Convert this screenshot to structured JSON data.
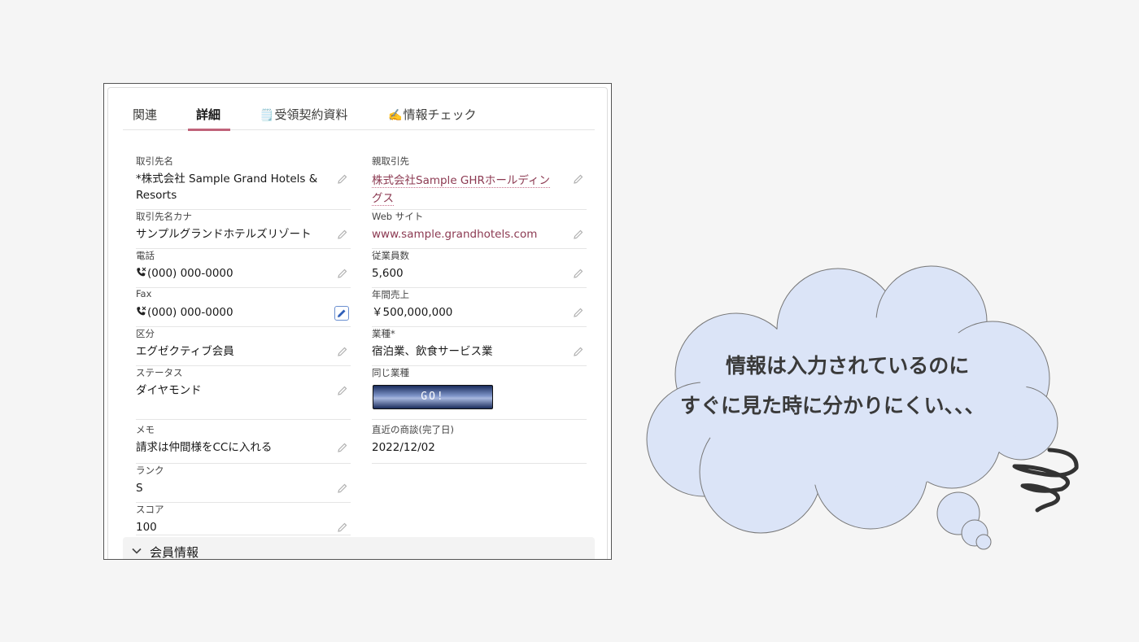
{
  "tabs": [
    {
      "label": "関連",
      "emoji": ""
    },
    {
      "label": "詳細",
      "emoji": ""
    },
    {
      "label": "受領契約資料",
      "emoji": "🗒️"
    },
    {
      "label": "情報チェック",
      "emoji": "✍️"
    }
  ],
  "left_fields": [
    {
      "label": "取引先名",
      "value": "*株式会社 Sample Grand Hotels & Resorts"
    },
    {
      "label": "取引先名カナ",
      "value": "サンプルグランドホテルズリゾート"
    },
    {
      "label": "電話",
      "value": "(000) 000-0000"
    },
    {
      "label": "Fax",
      "value": "(000) 000-0000"
    },
    {
      "label": "区分",
      "value": "エグゼクティブ会員"
    },
    {
      "label": "ステータス",
      "value": "ダイヤモンド"
    },
    {
      "label": "メモ",
      "value": "請求は仲間様をCCに入れる"
    },
    {
      "label": "ランク",
      "value": "S"
    },
    {
      "label": "スコア",
      "value": "100"
    }
  ],
  "right_fields": [
    {
      "label": "親取引先",
      "value": "株式会社Sample GHRホールディングス"
    },
    {
      "label": "Web サイト",
      "value": "www.sample.grandhotels.com"
    },
    {
      "label": "従業員数",
      "value": "5,600"
    },
    {
      "label": "年間売上",
      "value": "￥500,000,000"
    },
    {
      "label": "業種*",
      "value": "宿泊業、飲食サービス業"
    },
    {
      "label": "同じ業種",
      "value": ""
    },
    {
      "label": "直近の商談(完了日)",
      "value": "2022/12/02"
    }
  ],
  "go_button_label": "GO!",
  "section": {
    "title": "会員情報"
  },
  "bubble": {
    "line1": "情報は入力されているのに",
    "line2": "すぐに見た時に分かりにくい、、、"
  },
  "colors": {
    "tab_underline": "#c0637a",
    "link": "#8c3a52",
    "bubble_fill": "#dbe4f7",
    "bubble_stroke": "#777777"
  },
  "icons": [
    "phone-icon",
    "pencil-icon",
    "chevron-down-icon",
    "scribble-icon"
  ]
}
